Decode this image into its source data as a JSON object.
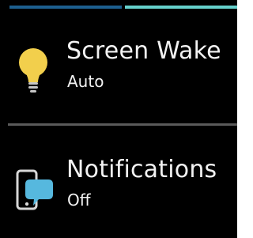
{
  "status_progress": {
    "segments": [
      "#1d5f8f",
      "#66d1cc"
    ]
  },
  "settings": {
    "items": [
      {
        "icon": "lightbulb-icon",
        "icon_color": "#f2cf4c",
        "title": "Screen Wake",
        "value": "Auto"
      },
      {
        "icon": "phone-notifications-icon",
        "icon_color": "#56b8de",
        "title": "Notifications",
        "value": "Off"
      }
    ]
  }
}
